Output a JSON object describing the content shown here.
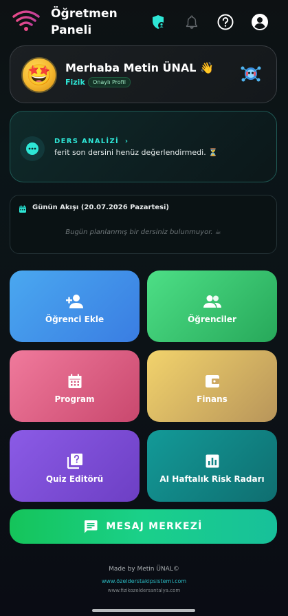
{
  "header": {
    "title_line1": "Öğretmen",
    "title_line2": "Paneli",
    "icons": [
      "wifi-logo-icon",
      "shield-user-icon",
      "bell-icon",
      "help-icon",
      "account-icon"
    ],
    "accent": "#2ee6d6"
  },
  "profile": {
    "greeting": "Merhaba Metin ÜNAL 👋",
    "subject": "Fizik",
    "badge": "Onaylı Profil",
    "avatar_emoji": "🤩"
  },
  "analysis": {
    "title": "DERS ANALİZİ",
    "chevron": "›",
    "text": "ferit son dersini henüz değerlendirmedi. ⏳"
  },
  "flow": {
    "title": "Günün Akışı (20.07.2026 Pazartesi)",
    "empty": "Bugün planlanmış bir dersiniz bulunmuyor. ☕"
  },
  "tiles": [
    {
      "label": "Öğrenci Ekle",
      "icon": "person-add-icon",
      "color": "#4aa8f0"
    },
    {
      "label": "Öğrenciler",
      "icon": "people-icon",
      "color": "#4ddf86"
    },
    {
      "label": "Program",
      "icon": "calendar-icon",
      "color": "#f07a9c"
    },
    {
      "label": "Finans",
      "icon": "wallet-icon",
      "color": "#f2d36c"
    },
    {
      "label": "Quiz Editörü",
      "icon": "quiz-icon",
      "color": "#8b5be6"
    },
    {
      "label": "AI Haftalık Risk Radarı",
      "icon": "analytics-icon",
      "color": "#139a98"
    }
  ],
  "message_center": {
    "label": "MESAJ MERKEZİ",
    "icon": "chat-icon"
  },
  "footer": {
    "made_by": "Made by Metin ÜNAL©",
    "link1": "www.özelderstakipsistemi.com",
    "link2": "www.fizikozeldersantalya.com"
  }
}
